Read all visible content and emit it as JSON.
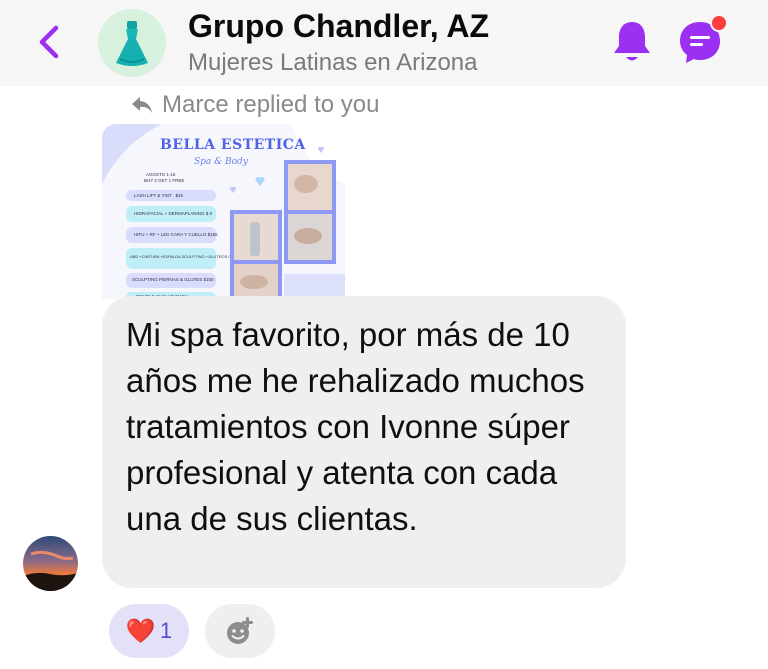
{
  "header": {
    "title": "Grupo Chandler, AZ",
    "subtitle": "Mujeres Latinas en Arizona"
  },
  "reply_note": "Marce replied to you",
  "flyer": {
    "brand": "BELLA ESTETICA",
    "tagline": "Spa & Body",
    "promo_header": "AGOSTO 1-15",
    "promo_sub": "BUY 2 GET 1 FREE",
    "services": [
      "LASH LIFT & TINT · $45",
      "HIDRAFACIAL + DERMAPLANING $ 9",
      "HIFU + RF + LED CARA Y CUELLO $165",
      "ABD +CINTURA +ESPALDA SCULPTING +GLUTEOS O BRAZOS $155",
      "SCULPTING PIERNAS & GLUTES $150",
      "DOUBLE CHIN / PAPADA"
    ]
  },
  "message": "Mi spa favorito, por más de 10 años me he rehalizado muchos tratamientos con Ivonne súper profesional y atenta con cada una de sus clientas.",
  "reaction": {
    "emoji": "❤️",
    "count": "1"
  },
  "colors": {
    "accent": "#9b30f2",
    "badge": "#ff3b3b",
    "bubble": "#efefef",
    "reaction_bg": "#e3e1f7"
  },
  "icons": [
    "back-chevron-icon",
    "dress-icon",
    "bell-icon",
    "messenger-icon",
    "reply-arrow-icon",
    "add-reaction-icon"
  ]
}
